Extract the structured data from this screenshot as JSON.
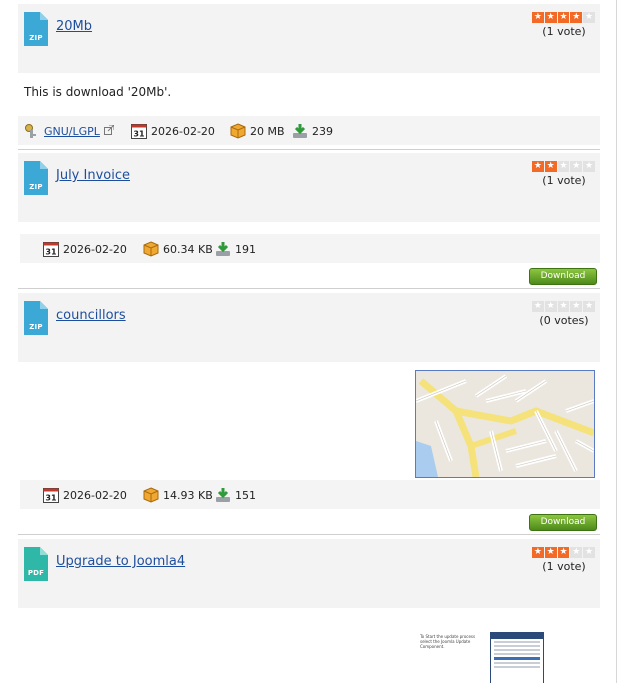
{
  "items": [
    {
      "title": "20Mb",
      "icon_type": "ZIP",
      "icon_color": "#3ba8d6",
      "rating_stars": 4,
      "votes": "(1 vote)",
      "description": "This is download '20Mb'.",
      "license": "GNU/LGPL",
      "date": "2026-02-20",
      "size": "20 MB",
      "downloads": "239"
    },
    {
      "title": "July Invoice",
      "icon_type": "ZIP",
      "icon_color": "#3ba8d6",
      "rating_stars": 2,
      "votes": "(1 vote)",
      "date": "2026-02-20",
      "size": "60.34 KB",
      "downloads": "191",
      "button": "Download"
    },
    {
      "title": "councillors",
      "icon_type": "ZIP",
      "icon_color": "#3ba8d6",
      "rating_stars": 0,
      "votes": "(0 votes)",
      "date": "2026-02-20",
      "size": "14.93 KB",
      "downloads": "151",
      "button": "Download"
    },
    {
      "title": "Upgrade to Joomla4",
      "icon_type": "PDF",
      "icon_color": "#2fb8a8",
      "rating_stars": 3,
      "votes": "(1 vote)",
      "preview_text": "To Start the update process select the Joomla Update Component."
    }
  ],
  "calendar_day": "31",
  "star_glyph": "★",
  "colors": {
    "star_on": "#f26a25",
    "star_off": "#e2e2e2",
    "link": "#1d4e9e",
    "button": "#5aa02c"
  }
}
